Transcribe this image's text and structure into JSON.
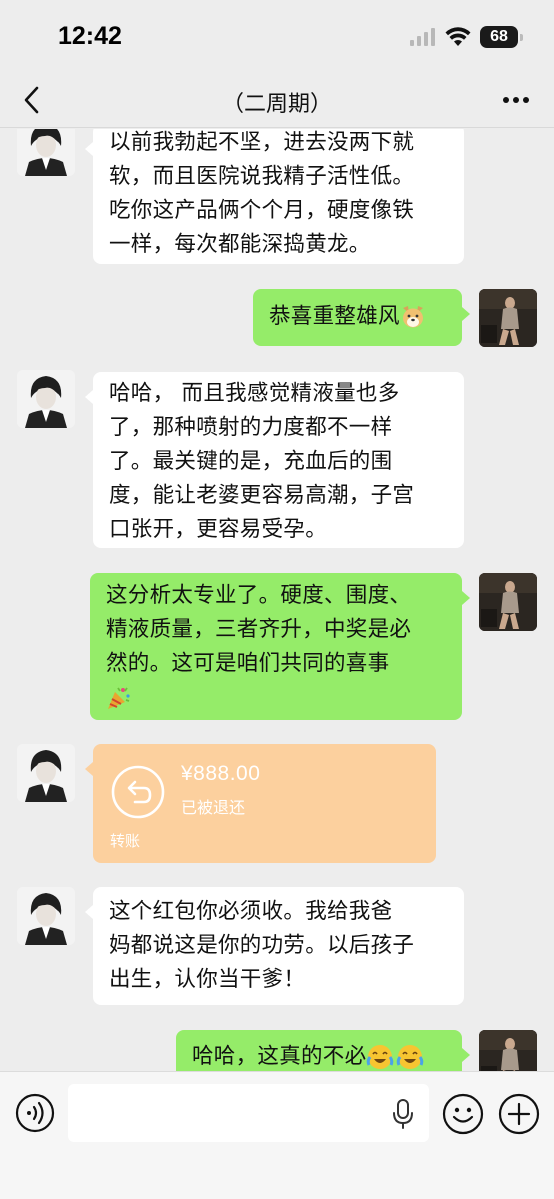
{
  "status_bar": {
    "time": "12:42",
    "battery": "68",
    "icons": [
      "signal-icon",
      "wifi-icon",
      "battery-icon"
    ]
  },
  "header": {
    "title": "（二周期）",
    "back_icon": "chevron-left-icon",
    "more_icon": "more-dots-icon"
  },
  "messages": [
    {
      "side": "in",
      "lines": [
        "以前我勃起不坚，进去没两下就",
        "软，而且医院说我精子活性低。",
        "吃你这产品俩个个月，硬度像铁",
        "一样，每次都能深捣黄龙。"
      ]
    },
    {
      "side": "out",
      "lines": [
        "恭喜重整雄风"
      ],
      "emoji": "dog-face-emoji"
    },
    {
      "side": "in",
      "lines": [
        "哈哈， 而且我感觉精液量也多",
        "了，那种喷射的力度都不一样",
        "了。最关键的是，充血后的围",
        "度，能让老婆更容易高潮，子宫",
        "口张开，更容易受孕。"
      ]
    },
    {
      "side": "out",
      "lines": [
        "这分析太专业了。硬度、围度、",
        "精液质量，三者齐升，中奖是必",
        "然的。这可是咱们共同的喜事"
      ],
      "emoji": "party-popper-emoji"
    },
    {
      "side": "in",
      "type": "transfer",
      "amount": "¥888.00",
      "status": "已被退还",
      "label": "转账",
      "icon": "return-arrow-icon"
    },
    {
      "side": "in",
      "lines": [
        " 这个红包你必须收。我给我爸",
        "妈都说这是你的功劳。以后孩子",
        "出生，认你当干爹！"
      ]
    },
    {
      "side": "out",
      "lines": [
        "哈哈，这真的不必"
      ],
      "emoji": "laughing-crying-emoji"
    }
  ],
  "input_bar": {
    "placeholder": "",
    "voice_icon": "voice-icon",
    "mic_icon": "mic-icon",
    "emoji_icon": "emoji-icon",
    "plus_icon": "plus-icon"
  }
}
